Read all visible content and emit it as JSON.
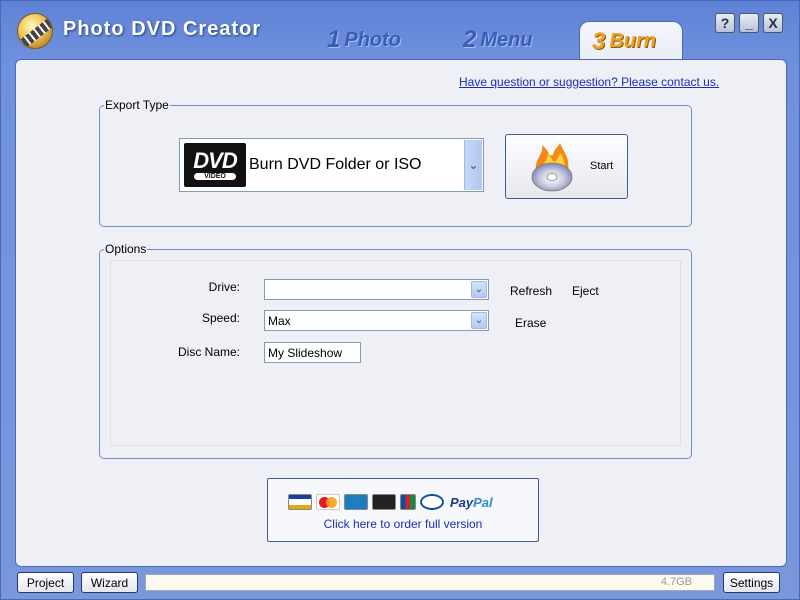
{
  "window": {
    "title": "Photo DVD Creator",
    "help_symbol": "?",
    "minimize_symbol": "_",
    "close_symbol": "X"
  },
  "steps": [
    {
      "number": "1",
      "label": "Photo",
      "active": false
    },
    {
      "number": "2",
      "label": "Menu",
      "active": false
    },
    {
      "number": "3",
      "label": "Burn",
      "active": true
    }
  ],
  "contact_link": "Have question or suggestion? Please contact us.",
  "export": {
    "legend": "Export Type",
    "logo_text": "DVD",
    "logo_subtext": "VIDEO",
    "selected": "Burn DVD Folder or ISO",
    "start_label": "Start"
  },
  "options": {
    "legend": "Options",
    "drive_label": "Drive:",
    "drive_value": "",
    "speed_label": "Speed:",
    "speed_value": "Max",
    "disc_name_label": "Disc Name:",
    "disc_name_value": "My Slideshow",
    "refresh_label": "Refresh",
    "eject_label": "Eject",
    "erase_label": "Erase"
  },
  "order": {
    "cards": [
      "visa-icon",
      "mastercard-icon",
      "amex-icon",
      "discover-icon",
      "jcb-icon",
      "diners-icon"
    ],
    "paypal_pay": "Pay",
    "paypal_pal": "Pal",
    "link": "Click here to order full version"
  },
  "bottom": {
    "project_label": "Project",
    "wizard_label": "Wizard",
    "capacity_label": "4.7GB",
    "settings_label": "Settings"
  },
  "colors": {
    "title_bar": "#6f90dc",
    "panel": "#eef0f6",
    "active_step": "#f0a020",
    "link": "#1a2fb8"
  }
}
